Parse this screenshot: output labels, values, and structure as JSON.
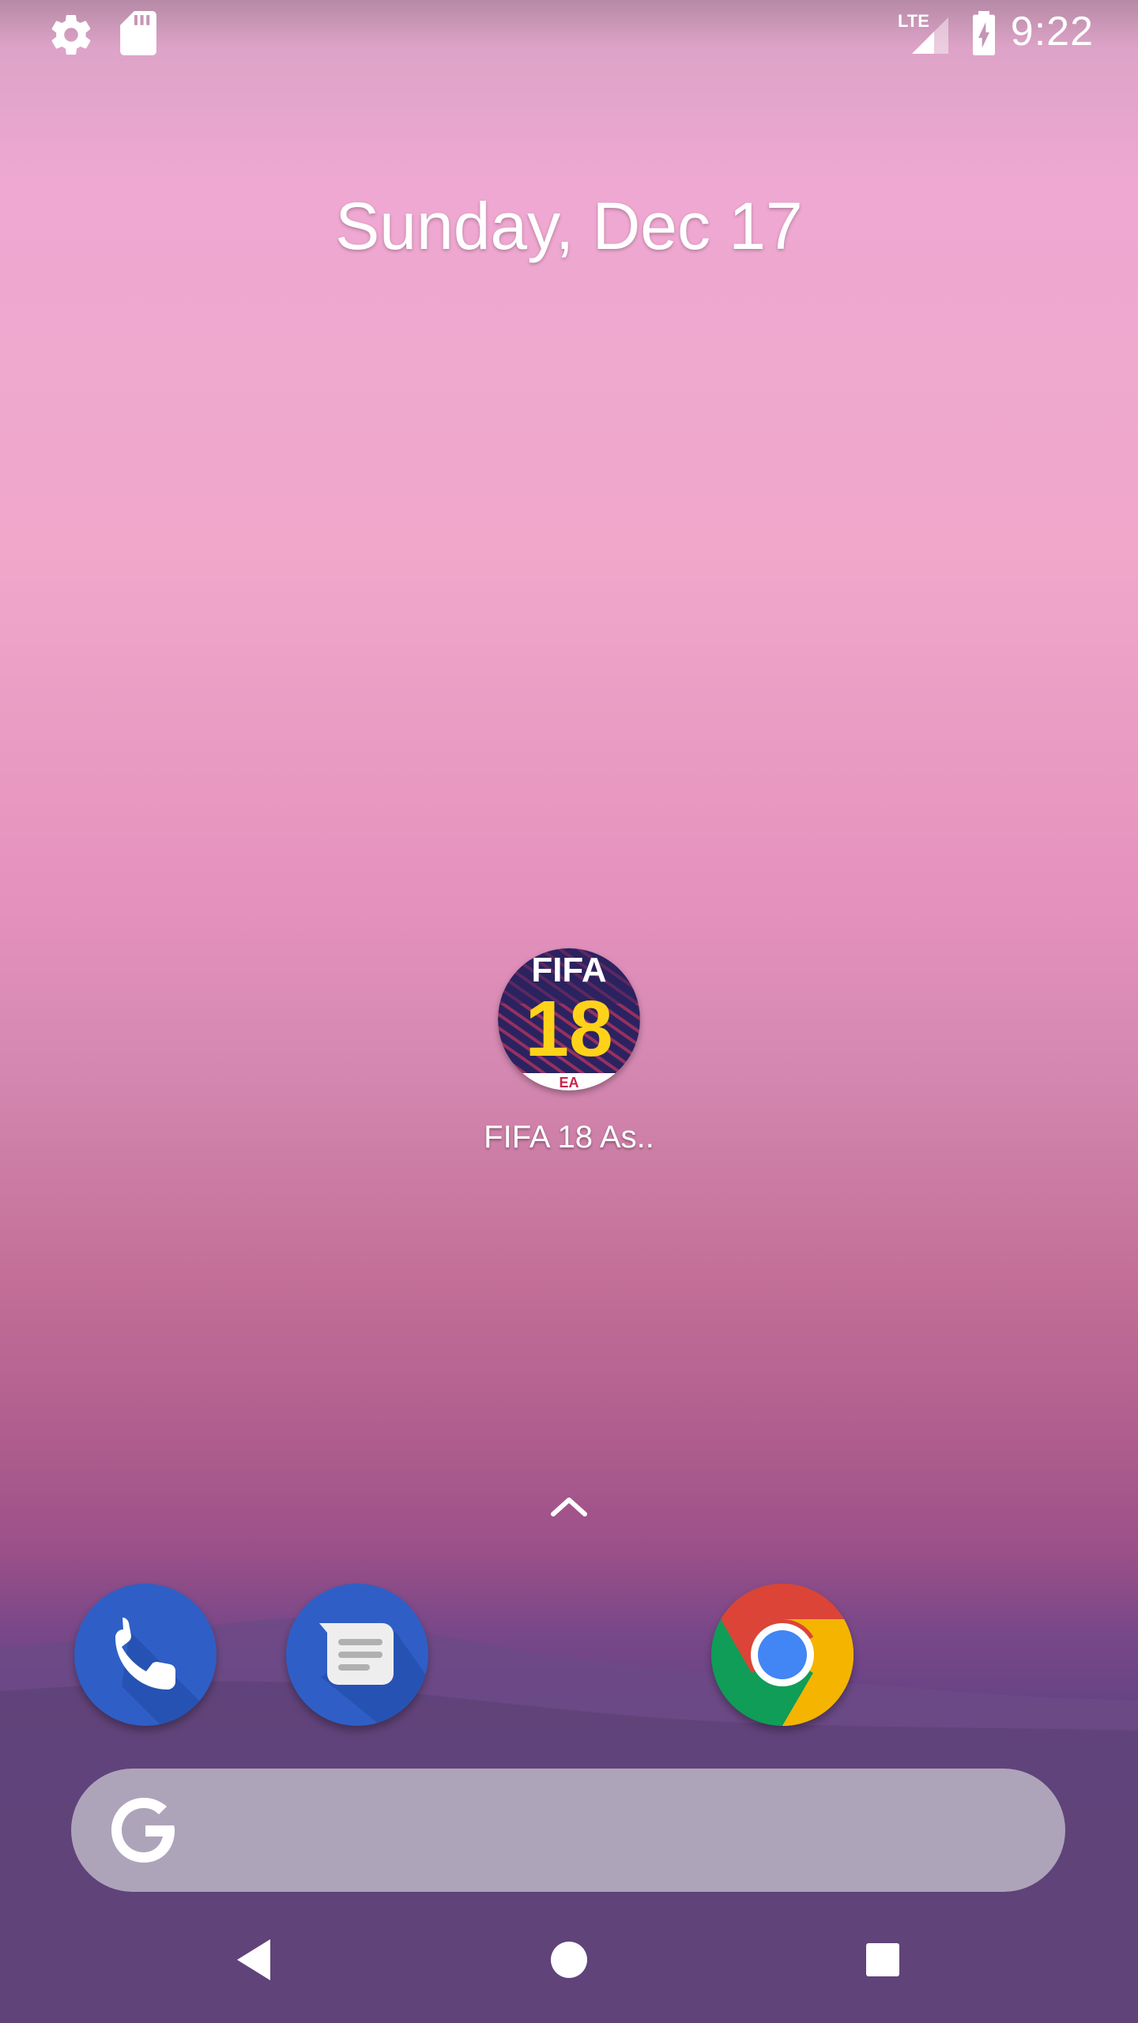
{
  "status_bar": {
    "time": "9:22",
    "network": "LTE",
    "icons": [
      "settings-icon",
      "sd-card-icon",
      "lte-signal-icon",
      "battery-charging-icon"
    ]
  },
  "home": {
    "date": "Sunday, Dec 17",
    "apps": [
      {
        "label": "FIFA 18 As..",
        "icon": "fifa-18-app-icon",
        "icon_text_top": "FIFA",
        "icon_text_main": "18",
        "icon_text_badge": "EA"
      }
    ]
  },
  "dock": {
    "items": [
      "phone-app-icon",
      "messages-app-icon",
      "chrome-app-icon"
    ]
  },
  "search": {
    "icon": "google-g-icon"
  },
  "nav": {
    "buttons": [
      "back-button",
      "home-button",
      "recents-button"
    ]
  },
  "colors": {
    "dock_blue": "#2f5fc6",
    "fifa_bg": "#2b2361",
    "fifa_yellow": "#ffd21a",
    "chrome_red": "#db4437",
    "chrome_green": "#0f9d58",
    "chrome_yellow": "#f4b400",
    "chrome_blue": "#4285f4"
  }
}
